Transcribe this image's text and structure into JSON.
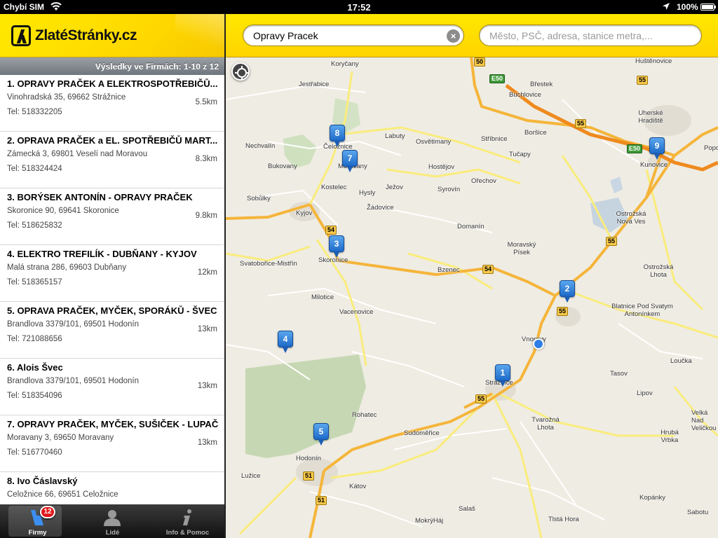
{
  "status_bar": {
    "carrier": "Chybí SIM",
    "time": "17:52",
    "battery": "100%"
  },
  "app": {
    "logo_text": "ZlatéStránky.cz"
  },
  "results_header": "Výsledky ve Firmách: 1-10 z 12",
  "results": [
    {
      "name": "1. OPRAVY PRAČEK A ELEKTROSPOTŘEBIČŮ...",
      "address": "Vinohradská 35, 69662 Strážnice",
      "tel": "Tel: 518332205",
      "distance": "5.5km"
    },
    {
      "name": "2. OPRAVA PRAČEK a EL. SPOTŘEBIČŮ MART...",
      "address": "Zámecká 3, 69801 Veselí nad Moravou",
      "tel": "Tel: 518324424",
      "distance": "8.3km"
    },
    {
      "name": "3. BORÝSEK ANTONÍN - OPRAVY PRAČEK",
      "address": "Skoronice 90, 69641 Skoronice",
      "tel": "Tel: 518625832",
      "distance": "9.8km"
    },
    {
      "name": "4. ELEKTRO TREFILÍK - DUBŇANY - KYJOV",
      "address": "Malá strana 286, 69603 Dubňany",
      "tel": "Tel: 518365157",
      "distance": "12km"
    },
    {
      "name": "5. OPRAVA PRAČEK, MYČEK, SPORÁKŮ - ŠVEC",
      "address": "Brandlova 3379/101, 69501 Hodonín",
      "tel": "Tel: 721088656",
      "distance": "13km"
    },
    {
      "name": "6. Alois Švec",
      "address": "Brandlova 3379/101, 69501 Hodonín",
      "tel": "Tel: 518354096",
      "distance": "13km"
    },
    {
      "name": "7. OPRAVY PRAČEK, MYČEK, SUŠIČEK - LUPAČ",
      "address": "Moravany 3, 69650 Moravany",
      "tel": "Tel: 516770460",
      "distance": "13km"
    },
    {
      "name": "8. Ivo Čáslavský",
      "address": "Čeložnice 66, 69651 Čeložnice",
      "tel": "",
      "distance": "15km"
    }
  ],
  "tabs": [
    {
      "label": "Firmy",
      "icon": "yellow-pages-icon",
      "badge": "12"
    },
    {
      "label": "Lidé",
      "icon": "person-icon"
    },
    {
      "label": "Info & Pomoc",
      "icon": "info-icon"
    }
  ],
  "search": {
    "query_value": "Opravy Pracek",
    "location_placeholder": "Město, PSČ, adresa, stanice metra,..."
  },
  "map": {
    "places": [
      "Koryčany",
      "Huštěnovice",
      "Jestřabice",
      "Břestek",
      "Buchlovice",
      "Uherské Hradiště",
      "Boršice",
      "Nechvalín",
      "Čeložnice",
      "Labuty",
      "Osvětimany",
      "Stříbnice",
      "Tučapy",
      "Bukovany",
      "Moravany",
      "Hostějov",
      "Kunovice",
      "Popo",
      "Kostelec",
      "Hysly",
      "Ježov",
      "Syrovín",
      "Ořechov",
      "Sobůlky",
      "Žádovice",
      "Kyjov",
      "Domanín",
      "Ostrožská Nová Ves",
      "Moravský Písek",
      "Svatobořice-Mistřín",
      "Skoronice",
      "Bzenec",
      "Ostrožská Lhota",
      "Milotice",
      "Blatnice Pod Svatym Antonínkem",
      "Vacenovice",
      "Vnorovy",
      "Loučka",
      "Tasov",
      "Lipov",
      "Strážnice",
      "Rohatec",
      "Tvarožná Lhota",
      "Velká Nad Veličkou",
      "Sudoměřice",
      "Hrubá Vrbka",
      "Hodonín",
      "Lužice",
      "Kátov",
      "Kopánky",
      "Salaš",
      "MokrýHáj",
      "Tlstá Hora",
      "Sabotu"
    ],
    "road_shields": [
      "50",
      "E50",
      "55",
      "55",
      "E50",
      "54",
      "54",
      "55",
      "55",
      "55",
      "51",
      "51"
    ],
    "pins": [
      "1",
      "2",
      "3",
      "4",
      "5",
      "7",
      "8",
      "9"
    ]
  }
}
